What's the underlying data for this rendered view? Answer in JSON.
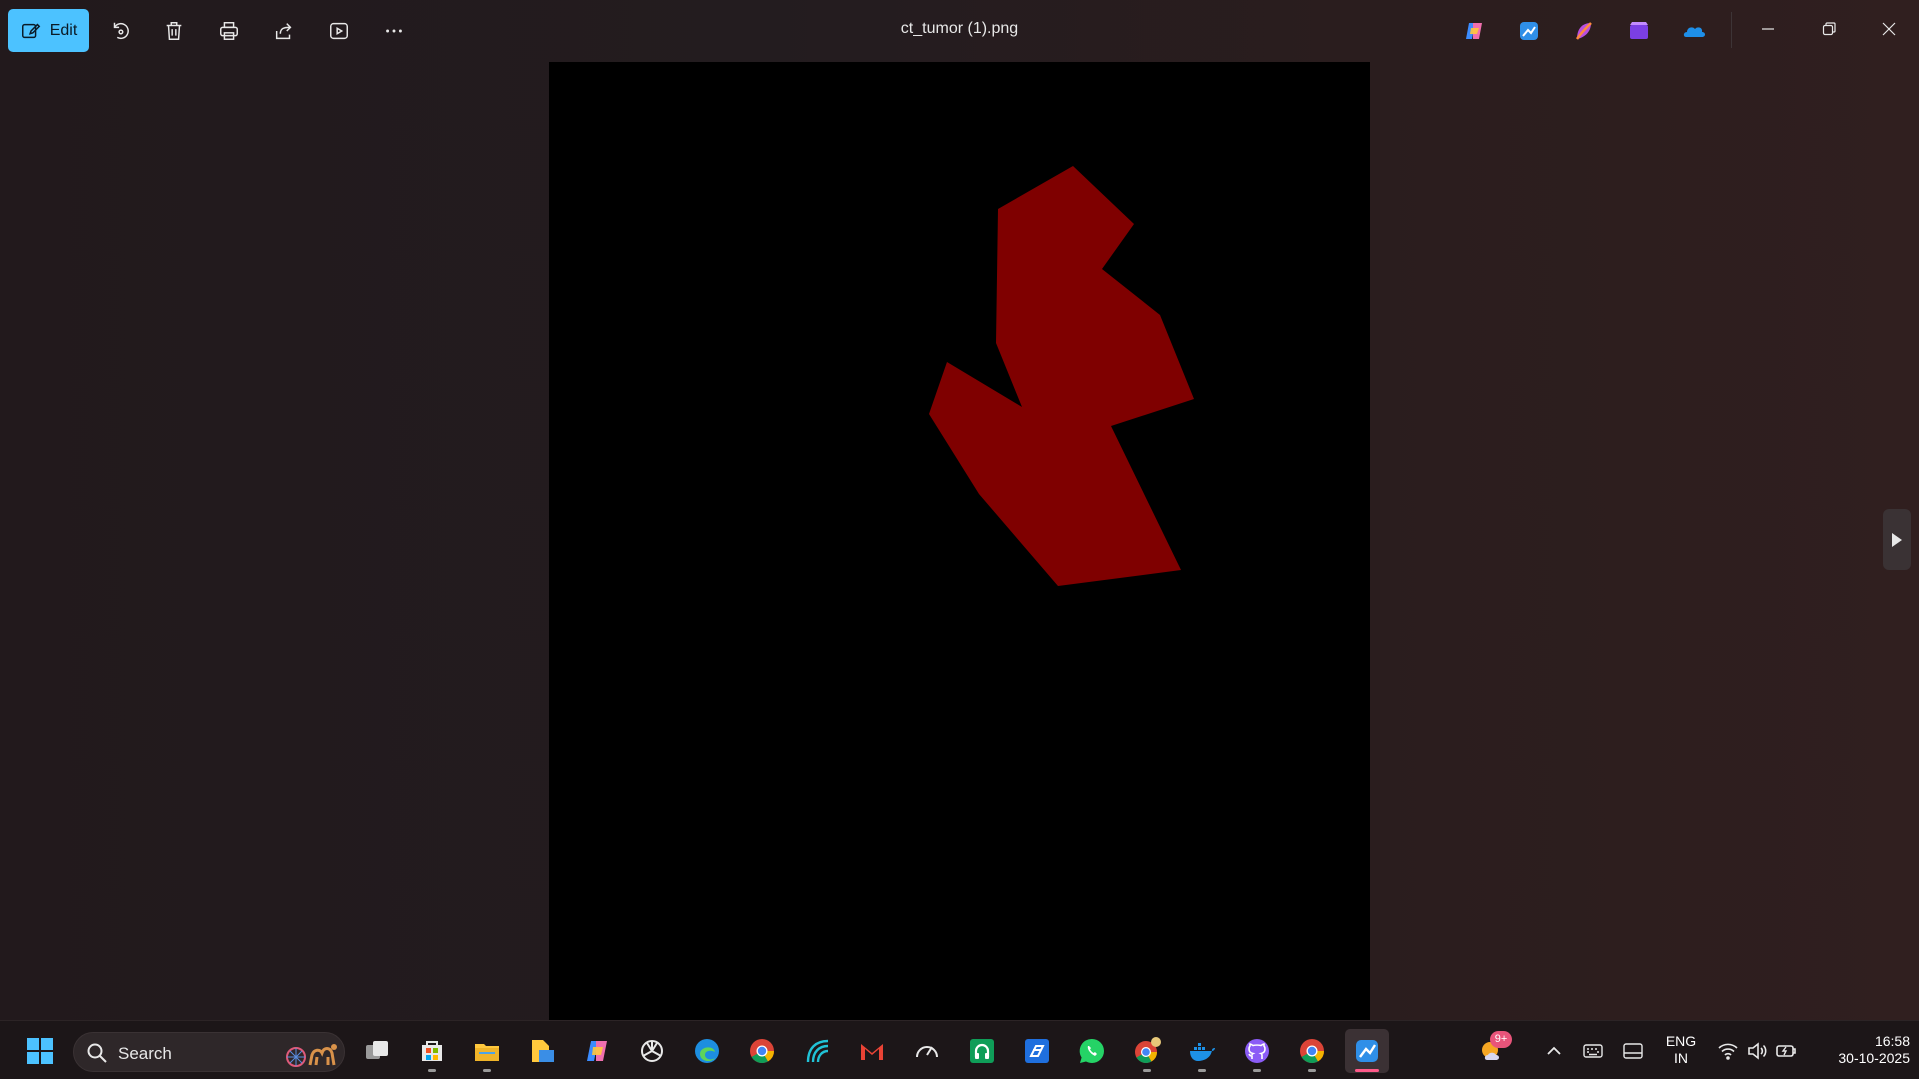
{
  "window": {
    "title": "ct_tumor (1).png"
  },
  "toolbar": {
    "edit_label": "Edit",
    "tools": [
      "rotate-icon",
      "delete-icon",
      "print-icon",
      "share-icon",
      "slideshow-icon",
      "more-icon"
    ]
  },
  "title_apps": [
    "copilot-icon",
    "photos-icon",
    "designer-icon",
    "clipchamp-icon",
    "onedrive-icon"
  ],
  "image": {
    "shape_color": "#7f0000",
    "background_color": "#000000"
  },
  "taskbar": {
    "search_label": "Search",
    "weather_badge": "9+",
    "language_line1": "ENG",
    "language_line2": "IN",
    "time": "16:58",
    "date": "30-10-2025"
  },
  "colors": {
    "accent": "#4cc2ff",
    "background": "#231c1f",
    "taskbar": "#1c1618"
  }
}
